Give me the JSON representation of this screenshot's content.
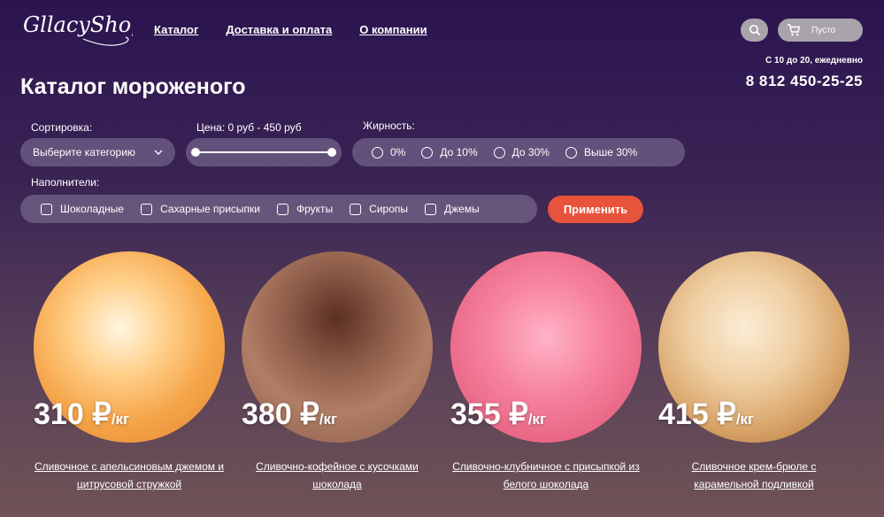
{
  "brand": {
    "logo_text": "GllacyShop"
  },
  "nav": [
    {
      "label": "Каталог"
    },
    {
      "label": "Доставка и оплата"
    },
    {
      "label": "О компании"
    }
  ],
  "header": {
    "cart_label": "Пусто",
    "hours": "С 10 до 20, ежедневно",
    "phone": "8 812 450-25-25"
  },
  "page_title": "Каталог мороженого",
  "filters": {
    "sort_label": "Сортировка:",
    "sort_value": "Выберите категорию",
    "price_label": "Цена: 0 руб - 450 руб",
    "fat_label": "Жирность:",
    "fat_options": [
      "0%",
      "До 10%",
      "До 30%",
      "Выше 30%"
    ],
    "fill_label": "Наполнители:",
    "fill_options": [
      "Шоколадные",
      "Сахарные присыпки",
      "Фрукты",
      "Сиропы",
      "Джемы"
    ],
    "apply_label": "Применить"
  },
  "products": [
    {
      "price": "310 ₽",
      "unit": "/кг",
      "name": "Сливочное с апельсиновым джемом и цитрусовой стружкой"
    },
    {
      "price": "380 ₽",
      "unit": "/кг",
      "name": "Сливочно-кофейное с кусочками шоколада"
    },
    {
      "price": "355 ₽",
      "unit": "/кг",
      "name": "Сливочно-клубничное с присыпкой из белого шоколада"
    },
    {
      "price": "415 ₽",
      "unit": "/кг",
      "name": "Сливочное крем-брюле с карамельной подливкой"
    }
  ]
}
